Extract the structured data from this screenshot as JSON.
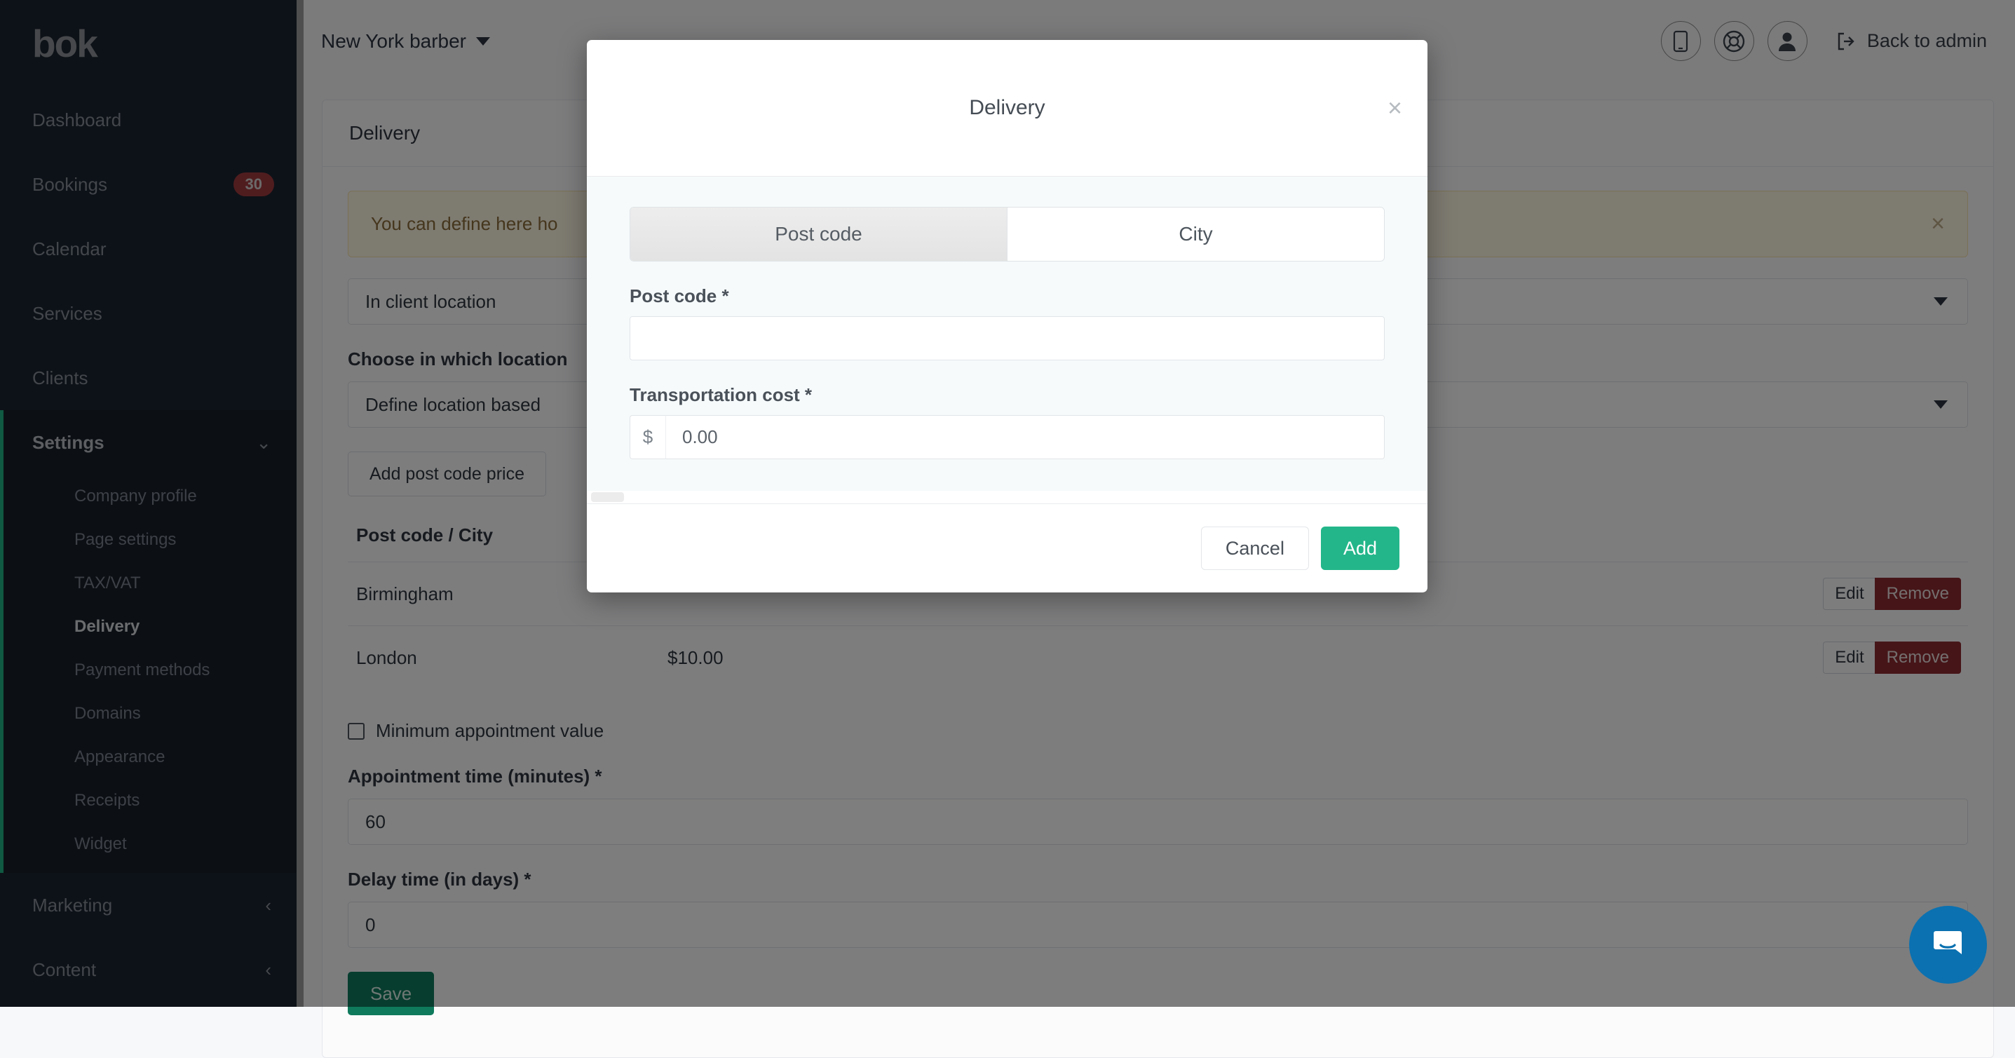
{
  "sidebar": {
    "logo": "bok",
    "items": [
      {
        "label": "Dashboard",
        "badge": null
      },
      {
        "label": "Bookings",
        "badge": "30"
      },
      {
        "label": "Calendar",
        "badge": null
      },
      {
        "label": "Services",
        "badge": null
      },
      {
        "label": "Clients",
        "badge": null
      }
    ],
    "settings": {
      "label": "Settings",
      "chevron": "⌄",
      "subitems": [
        {
          "label": "Company profile",
          "active": false
        },
        {
          "label": "Page settings",
          "active": false
        },
        {
          "label": "TAX/VAT",
          "active": false
        },
        {
          "label": "Delivery",
          "active": true
        },
        {
          "label": "Payment methods",
          "active": false
        },
        {
          "label": "Domains",
          "active": false
        },
        {
          "label": "Appearance",
          "active": false
        },
        {
          "label": "Receipts",
          "active": false
        },
        {
          "label": "Widget",
          "active": false
        }
      ]
    },
    "groups": [
      {
        "label": "Marketing",
        "chevron": "‹"
      },
      {
        "label": "Content",
        "chevron": "‹"
      }
    ]
  },
  "topbar": {
    "brand": "New York barber",
    "icons": [
      {
        "name": "mobile-icon"
      },
      {
        "name": "lifebuoy-icon"
      },
      {
        "name": "user-icon"
      }
    ],
    "back_to_admin": "Back to admin"
  },
  "page": {
    "card_title": "Delivery",
    "alert_text": "You can define here ho",
    "alert_close": "×",
    "location_select": "In client location",
    "location_label": "Choose in which location",
    "location_mode_select": "Define location based",
    "add_post_code_button": "Add post code price",
    "table": {
      "columns": [
        "Post code / City",
        ""
      ],
      "rows": [
        {
          "name": "Birmingham",
          "price": "",
          "edit": "Edit",
          "remove": "Remove"
        },
        {
          "name": "London",
          "price": "$10.00",
          "edit": "Edit",
          "remove": "Remove"
        }
      ]
    },
    "min_value_checkbox_label": "Minimum appointment value",
    "appointment_time_label": "Appointment time (minutes) *",
    "appointment_time_value": "60",
    "delay_time_label": "Delay time (in days) *",
    "delay_time_value": "0",
    "save_button": "Save"
  },
  "modal": {
    "title": "Delivery",
    "close": "×",
    "tabs": [
      {
        "label": "Post code",
        "active": true
      },
      {
        "label": "City",
        "active": false
      }
    ],
    "post_code_label": "Post code *",
    "post_code_value": "",
    "transportation_cost_label": "Transportation cost *",
    "currency_symbol": "$",
    "transportation_cost_value": "0.00",
    "cancel_button": "Cancel",
    "add_button": "Add"
  },
  "intercom": {
    "name": "intercom-chat-button"
  },
  "colors": {
    "accent_green": "#23b68a",
    "save_green": "#0f7a5c",
    "badge_red": "#a03a3f",
    "remove_red": "#8c2a30",
    "sidebar_bg": "#1b2430",
    "intercom_blue": "#0b71b0"
  }
}
